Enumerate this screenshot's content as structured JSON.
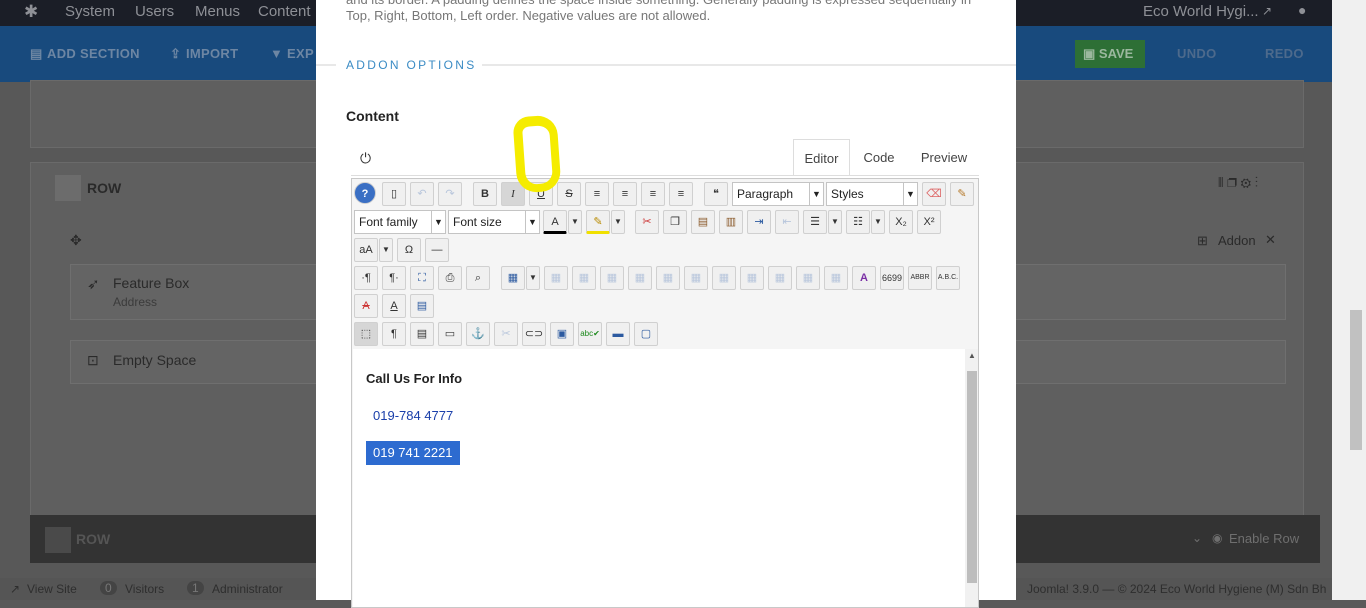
{
  "topbar": {
    "menus": [
      "System",
      "Users",
      "Menus",
      "Content"
    ],
    "site_name": "Eco World Hygi..."
  },
  "toolbar": {
    "add_section": "ADD SECTION",
    "import": "IMPORT",
    "export": "EXP",
    "save": "SAVE",
    "undo": "UNDO",
    "redo": "REDO"
  },
  "background": {
    "row1_label": "ROW",
    "addon_label": "Addon",
    "feature_box": "Feature Box",
    "feature_sub": "Address",
    "empty_space": "Empty Space",
    "row2_label": "ROW",
    "enable_row": "Enable Row"
  },
  "footer": {
    "view_site": "View Site",
    "visitors_count": "0",
    "visitors": "Visitors",
    "admin_count": "1",
    "administrator": "Administrator",
    "right": "Joomla! 3.9.0 — © 2024 Eco World Hygiene (M) Sdn Bh"
  },
  "modal": {
    "desc_line1": "and its border. A padding defines the space inside something. Generally padding is expressed sequentially in",
    "desc_line2": "Top, Right, Bottom, Left order. Negative values are not allowed.",
    "section_title": "ADDON OPTIONS",
    "content_label": "Content",
    "tabs": [
      "Editor",
      "Code",
      "Preview"
    ],
    "format_select": "Paragraph",
    "styles_select": "Styles",
    "font_family": "Font family",
    "font_size": "Font size",
    "editor_content": {
      "heading": "Call Us For Info",
      "phone1": "019-784 4777",
      "phone2": "019 741 2221"
    }
  },
  "colors": {
    "accent": "#3a8bc4",
    "selection": "#2d6bd0",
    "annotation": "#f5ec00"
  }
}
